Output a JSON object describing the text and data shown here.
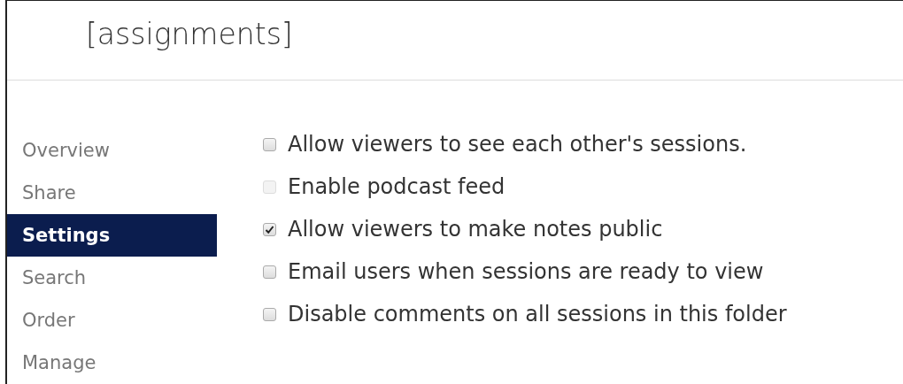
{
  "header": {
    "title": "[assignments]"
  },
  "sidebar": {
    "items": [
      {
        "label": "Overview",
        "selected": false
      },
      {
        "label": "Share",
        "selected": false
      },
      {
        "label": "Settings",
        "selected": true
      },
      {
        "label": "Search",
        "selected": false
      },
      {
        "label": "Order",
        "selected": false
      },
      {
        "label": "Manage",
        "selected": false
      }
    ]
  },
  "settings": [
    {
      "label": "Allow viewers to see each other's sessions.",
      "checked": false,
      "disabled": false
    },
    {
      "label": "Enable podcast feed",
      "checked": false,
      "disabled": true
    },
    {
      "label": "Allow viewers to make notes public",
      "checked": true,
      "disabled": false
    },
    {
      "label": "Email users when sessions are ready to view",
      "checked": false,
      "disabled": false
    },
    {
      "label": "Disable comments on all sessions in this folder",
      "checked": false,
      "disabled": false
    }
  ]
}
